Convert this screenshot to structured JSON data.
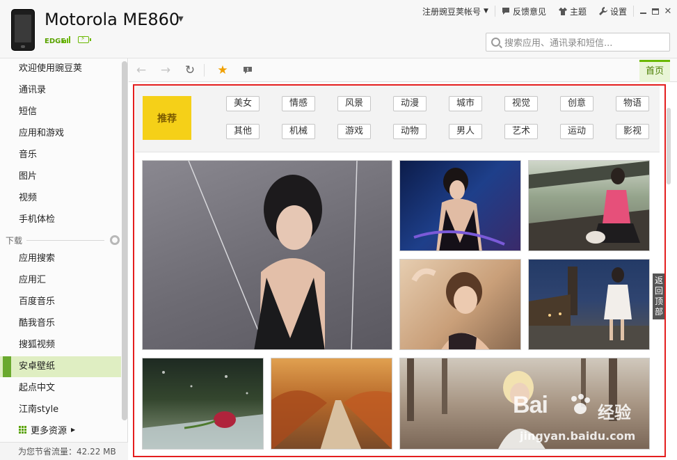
{
  "device": {
    "name": "Motorola ME860",
    "network": "EDGE"
  },
  "topbar": {
    "register": "注册豌豆荚帐号",
    "feedback": "反馈意见",
    "theme": "主题",
    "settings": "设置"
  },
  "search": {
    "placeholder": "搜索应用、通讯录和短信..."
  },
  "sidebar": {
    "items": [
      {
        "label": "欢迎使用豌豆荚"
      },
      {
        "label": "通讯录"
      },
      {
        "label": "短信"
      },
      {
        "label": "应用和游戏"
      },
      {
        "label": "音乐"
      },
      {
        "label": "图片"
      },
      {
        "label": "视频"
      },
      {
        "label": "手机体检"
      }
    ],
    "group_label": "下载",
    "download_items": [
      {
        "label": "应用搜索"
      },
      {
        "label": "应用汇"
      },
      {
        "label": "百度音乐"
      },
      {
        "label": "酷我音乐"
      },
      {
        "label": "搜狐视频"
      },
      {
        "label": "安卓壁纸"
      },
      {
        "label": "起点中文"
      },
      {
        "label": "江南style"
      }
    ],
    "more": "更多资源",
    "traffic": "为您节省流量：42.22 MB"
  },
  "browser": {
    "home_tab": "首页"
  },
  "categories": {
    "recommend": "推荐",
    "row1": [
      "美女",
      "情感",
      "风景",
      "动漫",
      "城市",
      "视觉",
      "创意",
      "物语"
    ],
    "row2": [
      "其他",
      "机械",
      "游戏",
      "动物",
      "男人",
      "艺术",
      "运动",
      "影视"
    ]
  },
  "back_to_top": "返回顶部",
  "watermark": {
    "brand": "Bai",
    "suffix": "经验",
    "url": "jingyan.baidu.com"
  },
  "colors": {
    "accent_green": "#6ab800",
    "frame_red": "#e41e1e",
    "recommend_yellow": "#f5d018",
    "active_row": "#dfeec2"
  }
}
